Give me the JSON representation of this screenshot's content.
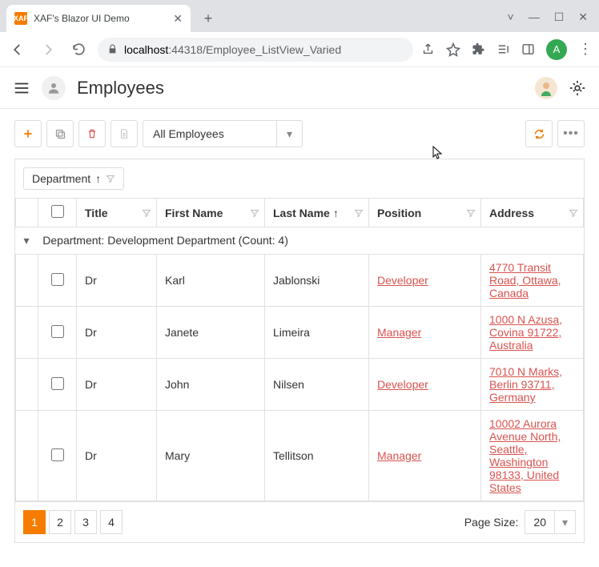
{
  "browser": {
    "tab_title": "XAF's Blazor UI Demo",
    "url_host": "localhost",
    "url_port": ":44318",
    "url_path": "/Employee_ListView_Varied",
    "avatar_letter": "A"
  },
  "header": {
    "title": "Employees"
  },
  "toolbar": {
    "filter_label": "All Employees"
  },
  "grid": {
    "group_chip": "Department",
    "columns": {
      "title": "Title",
      "first": "First Name",
      "last": "Last Name",
      "position": "Position",
      "address": "Address"
    },
    "group_row": "Department: Development Department (Count: 4)",
    "rows": [
      {
        "title": "Dr",
        "first": "Karl",
        "last": "Jablonski",
        "position": "Developer",
        "address": "4770 Transit Road, Ottawa, Canada"
      },
      {
        "title": "Dr",
        "first": "Janete",
        "last": "Limeira",
        "position": "Manager",
        "address": "1000 N Azusa, Covina 91722, Australia"
      },
      {
        "title": "Dr",
        "first": "John",
        "last": "Nilsen",
        "position": "Developer",
        "address": "7010 N Marks, Berlin 93711, Germany"
      },
      {
        "title": "Dr",
        "first": "Mary",
        "last": "Tellitson",
        "position": "Manager",
        "address": "10002 Aurora Avenue North, Seattle, Washington 98133, United States"
      }
    ]
  },
  "pager": {
    "pages": [
      "1",
      "2",
      "3",
      "4"
    ],
    "active": "1",
    "size_label": "Page Size:",
    "size_value": "20"
  }
}
